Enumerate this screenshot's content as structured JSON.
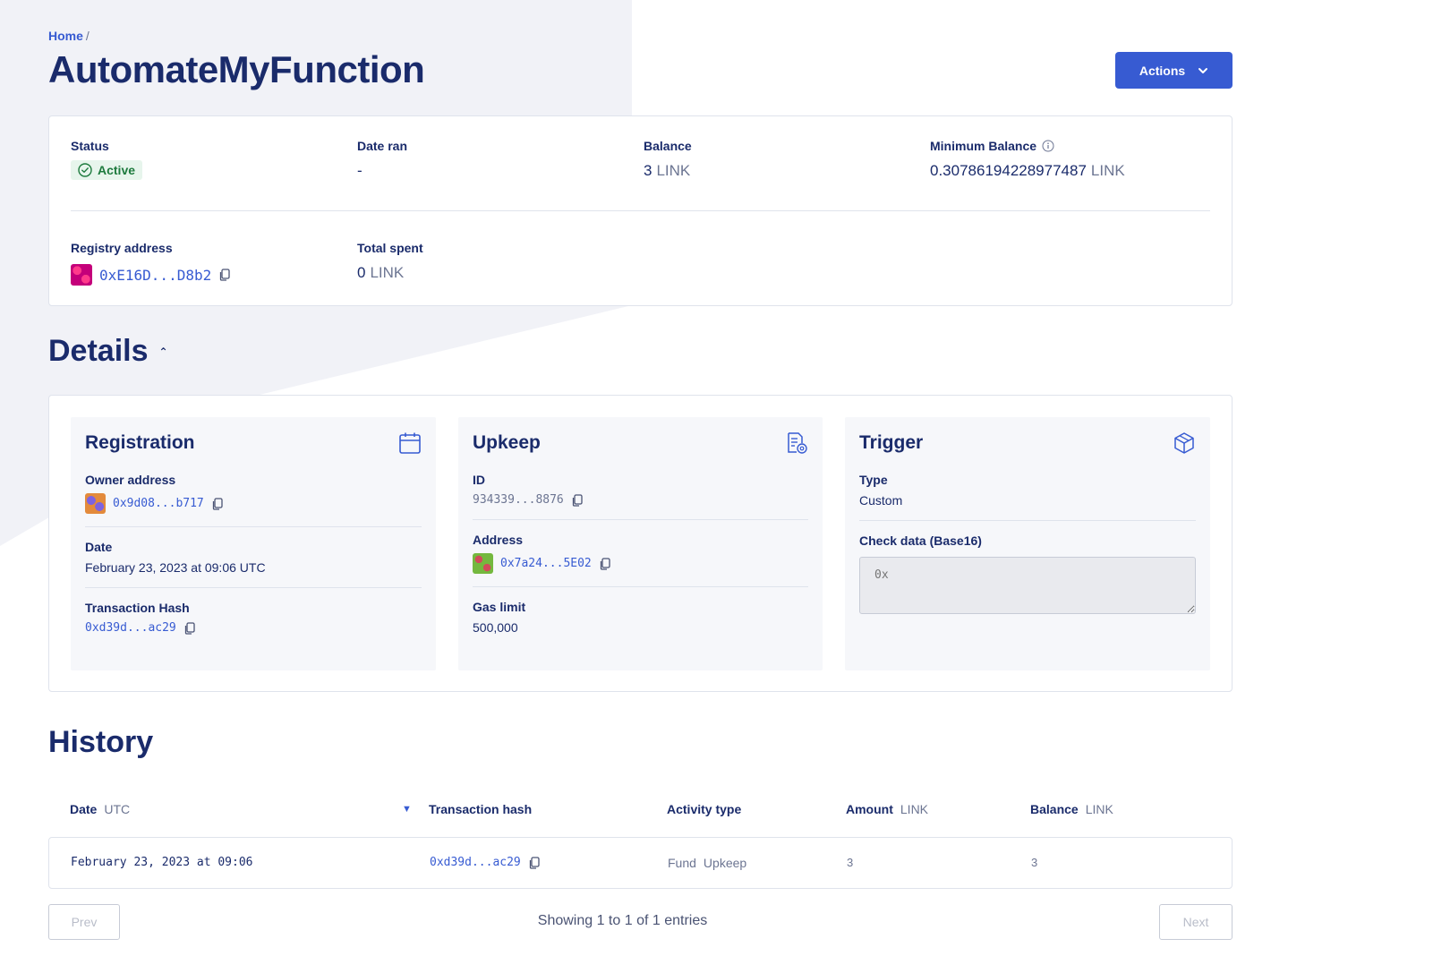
{
  "breadcrumb": {
    "home": "Home",
    "separator": "/"
  },
  "page": {
    "title": "AutomateMyFunction"
  },
  "actions_button": {
    "label": "Actions",
    "icon": "chevron-down-icon"
  },
  "summary": {
    "status": {
      "label": "Status",
      "value": "Active"
    },
    "date_ran": {
      "label": "Date ran",
      "value": "-"
    },
    "balance": {
      "label": "Balance",
      "value": "3",
      "unit": "LINK"
    },
    "minimum_balance": {
      "label": "Minimum Balance",
      "value": "0.30786194228977487",
      "unit": "LINK"
    },
    "registry_address": {
      "label": "Registry address",
      "value": "0xE16D...D8b2"
    },
    "total_spent": {
      "label": "Total spent",
      "value": "0",
      "unit": "LINK"
    }
  },
  "details": {
    "title": "Details",
    "registration": {
      "title": "Registration",
      "icon": "calendar-icon",
      "owner_address_label": "Owner address",
      "owner_address": "0x9d08...b717",
      "date_label": "Date",
      "date": "February 23, 2023 at 09:06 UTC",
      "tx_hash_label": "Transaction Hash",
      "tx_hash": "0xd39d...ac29"
    },
    "upkeep": {
      "title": "Upkeep",
      "icon": "document-settings-icon",
      "id_label": "ID",
      "id": "934339...8876",
      "address_label": "Address",
      "address": "0x7a24...5E02",
      "gas_limit_label": "Gas limit",
      "gas_limit": "500,000"
    },
    "trigger": {
      "title": "Trigger",
      "icon": "cube-icon",
      "type_label": "Type",
      "type": "Custom",
      "check_data_label": "Check data (Base16)",
      "check_data_placeholder": "0x"
    }
  },
  "history": {
    "title": "History",
    "columns": [
      {
        "label": "Date",
        "unit": "UTC"
      },
      {
        "label": "Transaction hash",
        "unit": ""
      },
      {
        "label": "Activity type",
        "unit": ""
      },
      {
        "label": "Amount",
        "unit": "LINK"
      },
      {
        "label": "Balance",
        "unit": "LINK"
      }
    ],
    "rows": [
      {
        "date": "February 23, 2023 at 09:06",
        "tx_hash": "0xd39d...ac29",
        "activity_a": "Fund",
        "activity_b": "Upkeep",
        "amount": "3",
        "balance": "3"
      }
    ],
    "pagination": {
      "prev": "Prev",
      "next": "Next",
      "info": "Showing 1 to 1 of 1 entries"
    }
  },
  "colors": {
    "accent": "#375bd2",
    "title": "#1a2b6b",
    "status_green": "#1d7a3d"
  }
}
